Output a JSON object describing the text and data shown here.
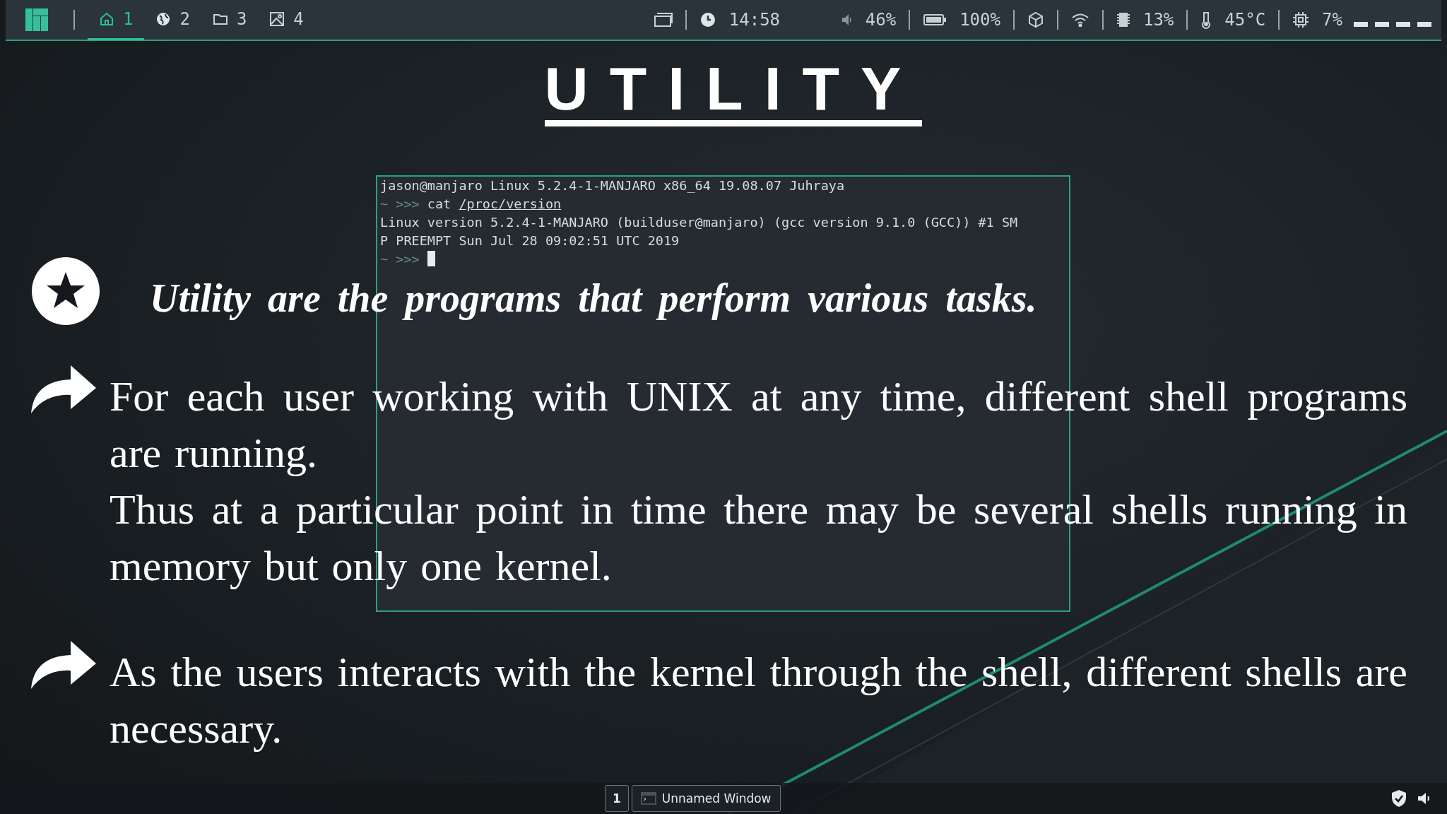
{
  "top_bar": {
    "workspaces": [
      {
        "kind": "home",
        "label": "1",
        "selected": true
      },
      {
        "kind": "globe",
        "label": "2",
        "selected": false
      },
      {
        "kind": "folder",
        "label": "3",
        "selected": false
      },
      {
        "kind": "image",
        "label": "4",
        "selected": false
      }
    ],
    "clock": "14:58",
    "indicators": [
      {
        "kind": "volume",
        "text": "46%"
      },
      {
        "kind": "battery",
        "text": "100%"
      },
      {
        "kind": "package"
      },
      {
        "kind": "wifi"
      },
      {
        "kind": "memory",
        "text": "13%"
      },
      {
        "kind": "temperature",
        "text": "45°C"
      },
      {
        "kind": "cpu",
        "text": "7%"
      }
    ]
  },
  "terminal": {
    "lines": [
      {
        "kind": "output",
        "text": "jason@manjaro Linux 5.2.4-1-MANJARO x86_64 19.08.07 Juhraya"
      },
      {
        "kind": "command",
        "prompt": "~ >>>",
        "command": "cat",
        "argument": "/proc/version"
      },
      {
        "kind": "output",
        "text": "Linux version 5.2.4-1-MANJARO (builduser@manjaro) (gcc version 9.1.0 (GCC)) #1 SM"
      },
      {
        "kind": "output",
        "text": "P PREEMPT Sun Jul 28 09:02:51 UTC 2019"
      },
      {
        "kind": "cursor",
        "prompt": "~ >>>"
      }
    ]
  },
  "slide": {
    "title": "UTILITY",
    "points": [
      {
        "kind": "star",
        "paragraphs": [
          "Utility are the programs  that perform various tasks."
        ]
      },
      {
        "kind": "arrow",
        "paragraphs": [
          "For each user working with UNIX at any time, different shell programs are running.",
          "Thus at a particular point in time there may be several shells running in memory but only one kernel."
        ]
      },
      {
        "kind": "arrow",
        "paragraphs": [
          "As the users interacts with the kernel through the shell, different shells are necessary."
        ]
      }
    ]
  },
  "bottom_bar": {
    "workspace": "1",
    "window_title": "Unnamed Window"
  }
}
